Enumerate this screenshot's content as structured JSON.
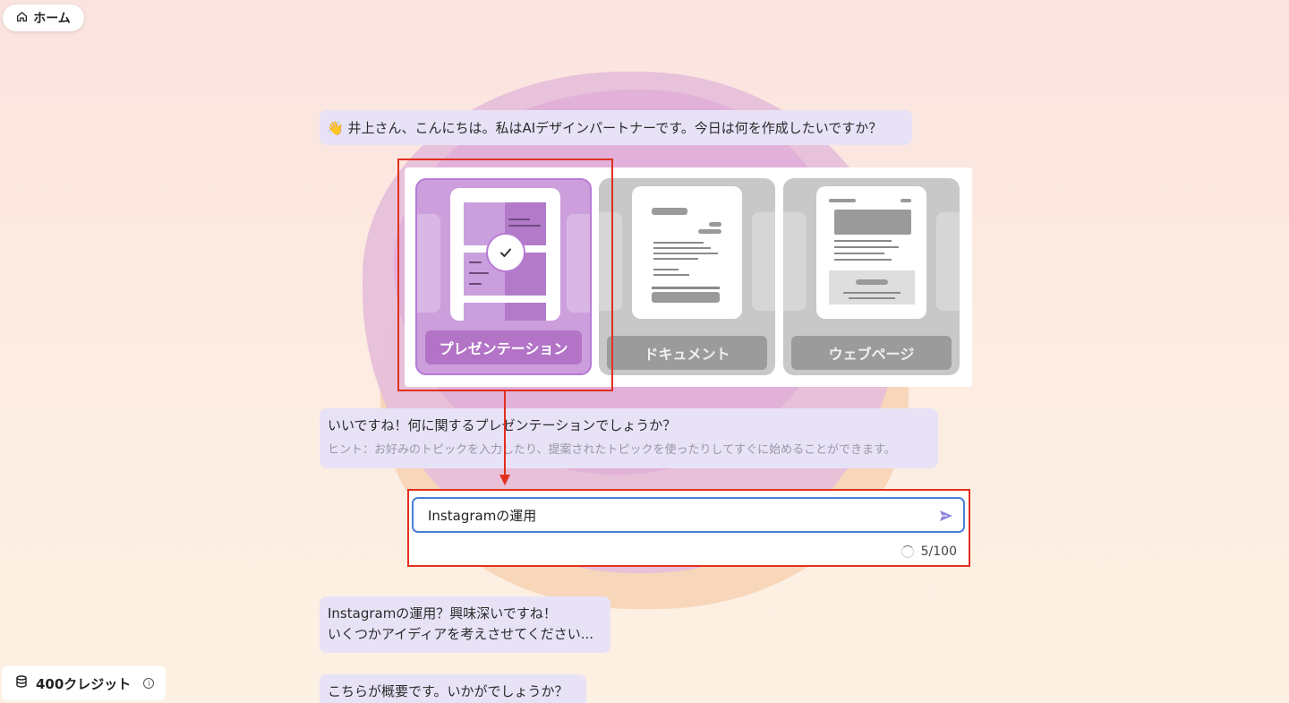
{
  "home": {
    "label": "ホーム",
    "icon": "home-icon"
  },
  "credits": {
    "label": "400クレジット",
    "icon": "coins-icon",
    "info_icon": "info-icon"
  },
  "chat": {
    "greeting": "👋 井上さん、こんにちは。私はAIデザインパートナーです。今日は何を作成したいですか？",
    "question": "いいですね！何に関するプレゼンテーションでしょうか？",
    "hint": "ヒント：お好みのトピックを入力したり、提案されたトピックを使ったりしてすぐに始めることができます。",
    "reply_line1": "Instagramの運用？興味深いですね！",
    "reply_line2": "いくつかアイディアを考えさせてください...",
    "reply2": "こちらが概要です。いかがでしょうか？"
  },
  "options": {
    "presentation": {
      "label": "プレゼンテーション",
      "selected": true
    },
    "document": {
      "label": "ドキュメント",
      "selected": false
    },
    "webpage": {
      "label": "ウェブページ",
      "selected": false
    }
  },
  "input": {
    "value": "Instagramの運用",
    "counter": "5/100",
    "send_icon": "send-icon"
  },
  "colors": {
    "accent_purple": "#b374c7",
    "bubble": "#e8e2f7",
    "annotation_red": "#e2301f",
    "input_border": "#4a7ed6"
  }
}
